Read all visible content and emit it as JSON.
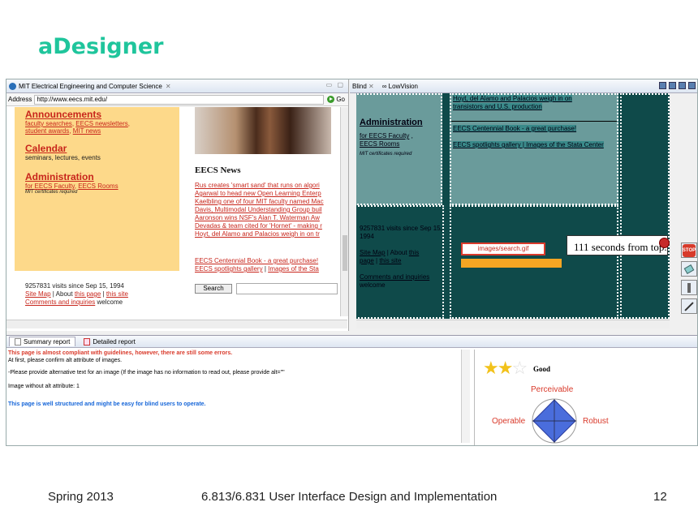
{
  "slide": {
    "title": "aDesigner",
    "footer_left": "Spring 2013",
    "footer_center": "6.813/6.831 User Interface Design and Implementation",
    "footer_right": "12"
  },
  "browser": {
    "tab_title": "MIT Electrical Engineering and Computer Science",
    "address_label": "Address",
    "address_value": "http://www.eecs.mit.edu/",
    "go_label": "Go",
    "announcements": {
      "title": "Announcements",
      "links": [
        "faculty searches",
        "EECS newsletters",
        "student awards",
        "MIT news"
      ]
    },
    "calendar": {
      "title": "Calendar",
      "text": "seminars, lectures, events"
    },
    "administration": {
      "title": "Administration",
      "prefix": "for EECS Faculty",
      "link1": "for EECS Faculty",
      "link2": "EECS Rooms",
      "note": "MIT certificates required"
    },
    "visits": "9257831 visits since Sep 15, 1994",
    "site_map": "Site Map",
    "about": "About",
    "this_page": "this page",
    "this_site": "this site",
    "comments": "Comments and inquiries",
    "welcome": "welcome",
    "news_title": "EECS News",
    "news_items": [
      "Rus creates 'smart sand' that runs on algori",
      "Agarwal to head new Open Learning Enterp",
      "Kaelbling one of four MIT faculty named Mac",
      "Davis, Multimodal Understanding Group buil",
      "Aaronson wins NSF's Alan T. Waterman Aw",
      "Devadas & team cited for 'Hornet' - making r",
      "Hoyt, del Alamo and Palacios weigh in on tr"
    ],
    "centennial": "EECS Centennial Book - a great purchase!",
    "spotlights": "EECS spotlights gallery",
    "images_stata": "Images of the Sta",
    "search_label": "Search"
  },
  "blind": {
    "tab_blind": "Blind",
    "tab_lowvision": "LowVision",
    "top_text1": "Hoyt, del Alamo and Palacios weigh in on",
    "top_text2": "transistors and U.S. production",
    "admin_title": "Administration",
    "admin_link1": "for EECS Faculty",
    "admin_link2": "EECS Rooms",
    "admin_note": "MIT certificates required",
    "centennial": "EECS Centennial Book - a great purchase!",
    "spotlights": "EECS spotlights gallery | Images of the Stata Center",
    "visits": "9257831 visits since Sep 15, 1994",
    "site_map": "Site Map",
    "about": "About",
    "this": "this",
    "page": "page",
    "this_site": "this site",
    "comments": "Comments and inquiries",
    "welcome": "welcome",
    "image_box": "images/search.gif",
    "balloon": "111 seconds from top.",
    "tools": [
      "stop-icon",
      "eraser-icon",
      "highlighter-icon",
      "pen-icon"
    ],
    "stop_label": "STOP"
  },
  "summary": {
    "tab_summary": "Summary report",
    "tab_detailed": "Detailed report",
    "line_red": "This page is almost compliant with guidelines, however, there are still some errors.",
    "line1": "At first, please confirm alt attribute of images.",
    "line2": " -Please provide alternative text for an image (If the image has no information to read out, please provide alt=\"\"",
    "line3": "Image without alt attribute: 1",
    "line_blue": "This page is well structured and might be easy for blind users to operate.",
    "rating_label": "Good",
    "rating_value": 2,
    "rating_max": 3,
    "perceivable": "Perceivable",
    "operable": "Operable",
    "robust": "Robust"
  },
  "colors": {
    "title": "#1fc59c",
    "dark_teal": "#0f4a4a",
    "link_red": "#c8261c",
    "accent_orange": "#f5a623",
    "radar_blue": "#4a6ddc"
  }
}
